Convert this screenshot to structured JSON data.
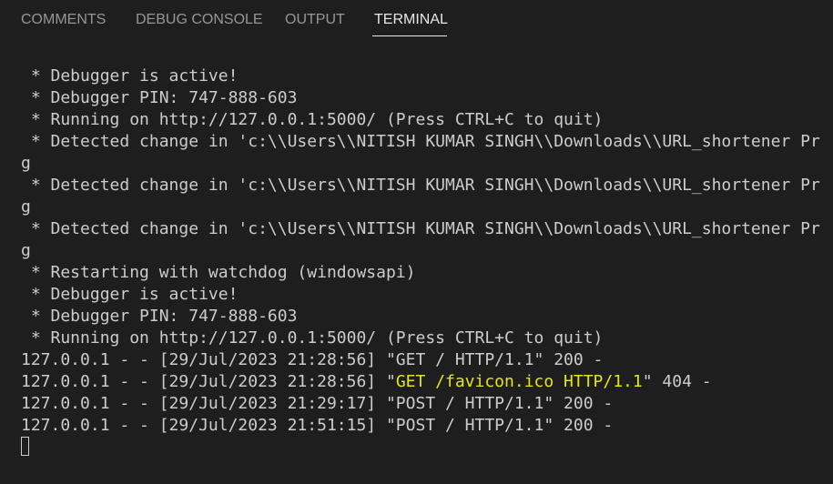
{
  "tabs": [
    {
      "label": "COMMENTS",
      "active": false
    },
    {
      "label": "DEBUG CONSOLE",
      "active": false
    },
    {
      "label": "OUTPUT",
      "active": false
    },
    {
      "label": "TERMINAL",
      "active": true
    }
  ],
  "terminal": {
    "lines": [
      " * Debugger is active!",
      " * Debugger PIN: 747-888-603",
      " * Running on http://127.0.0.1:5000/ (Press CTRL+C to quit)",
      " * Detected change in 'c:\\\\Users\\\\NITISH KUMAR SINGH\\\\Downloads\\\\URL_shortener Pr",
      "g",
      " * Detected change in 'c:\\\\Users\\\\NITISH KUMAR SINGH\\\\Downloads\\\\URL_shortener Pr",
      "g",
      " * Detected change in 'c:\\\\Users\\\\NITISH KUMAR SINGH\\\\Downloads\\\\URL_shortener Pr",
      "g",
      " * Restarting with watchdog (windowsapi)",
      " * Debugger is active!",
      " * Debugger PIN: 747-888-603",
      " * Running on http://127.0.0.1:5000/ (Press CTRL+C to quit)",
      "127.0.0.1 - - [29/Jul/2023 21:28:56] \"GET / HTTP/1.1\" 200 -"
    ],
    "favicon_line": {
      "prefix": "127.0.0.1 - - [29/Jul/2023 21:28:56] \"",
      "highlight": "GET /favicon.ico HTTP/1.1",
      "suffix": "\" 404 -"
    },
    "tail_lines": [
      "127.0.0.1 - - [29/Jul/2023 21:29:17] \"POST / HTTP/1.1\" 200 -",
      "127.0.0.1 - - [29/Jul/2023 21:51:15] \"POST / HTTP/1.1\" 200 -"
    ],
    "highlight_color": "#e5e510"
  }
}
